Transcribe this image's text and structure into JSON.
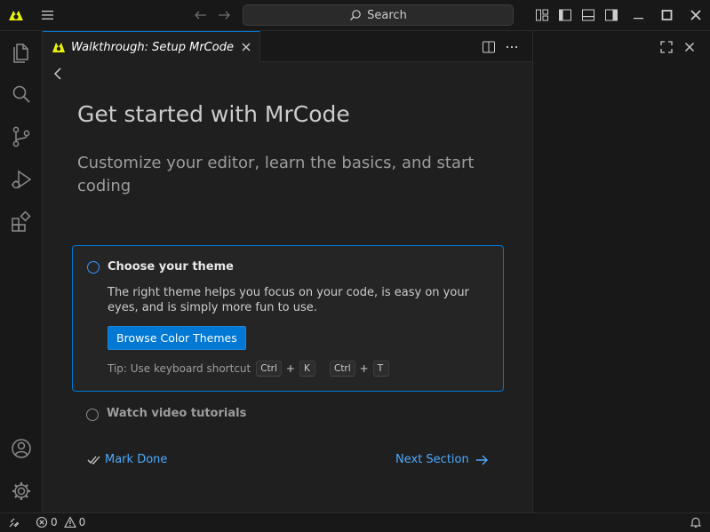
{
  "titlebar": {
    "search_label": "Search"
  },
  "tab": {
    "label": "Walkthrough: Setup MrCode"
  },
  "walkthrough": {
    "title": "Get started with MrCode",
    "subtitle": "Customize your editor, learn the basics, and start coding",
    "steps": [
      {
        "title": "Choose your theme",
        "description": "The right theme helps you focus on your code, is easy on your eyes, and is simply more fun to use.",
        "button_label": "Browse Color Themes",
        "tip_label": "Tip: Use keyboard shortcut",
        "shortcut": [
          "Ctrl",
          "K",
          "Ctrl",
          "T"
        ],
        "plus": "+"
      },
      {
        "title": "Watch video tutorials"
      }
    ],
    "mark_done_label": "Mark Done",
    "next_section_label": "Next Section"
  },
  "statusbar": {
    "errors": "0",
    "warnings": "0"
  },
  "colors": {
    "accent": "#0078d4",
    "link": "#4daafc",
    "logo_yellow": "#e8f20a"
  }
}
